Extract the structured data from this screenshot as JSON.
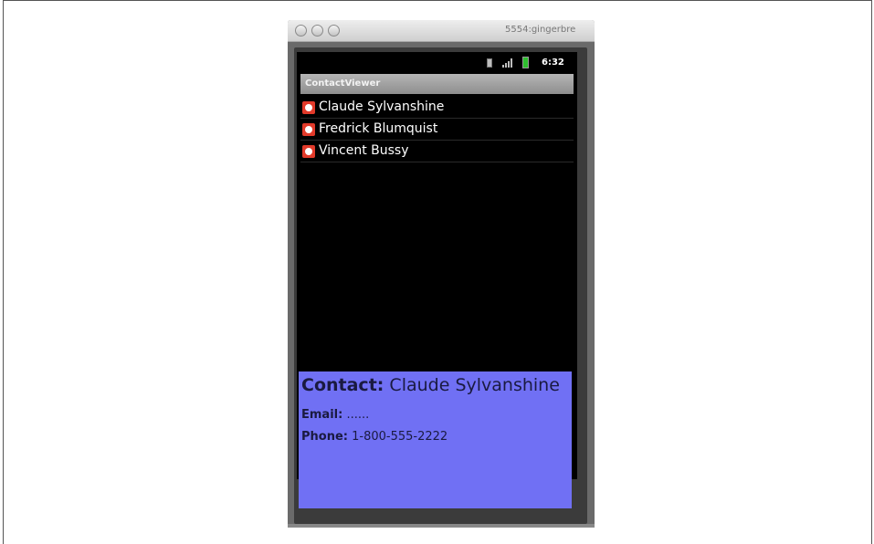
{
  "window": {
    "title": "5554:gingerbre"
  },
  "statusbar": {
    "time": "6:32",
    "icons": [
      "sim-icon",
      "signal-icon",
      "battery-icon"
    ]
  },
  "app": {
    "title": "ContactViewer"
  },
  "contacts": [
    {
      "name": "Claude Sylvanshine"
    },
    {
      "name": "Fredrick Blumquist"
    },
    {
      "name": "Vincent Bussy"
    }
  ],
  "detail": {
    "contact_label": "Contact:",
    "contact_value": "Claude Sylvanshine",
    "email_label": "Email:",
    "email_value": "......",
    "phone_label": "Phone:",
    "phone_value": "1-800-555-2222"
  },
  "colors": {
    "detail_bg": "#7070f4",
    "battery": "#2fbf2f",
    "contact_icon": "#e23a2a"
  }
}
